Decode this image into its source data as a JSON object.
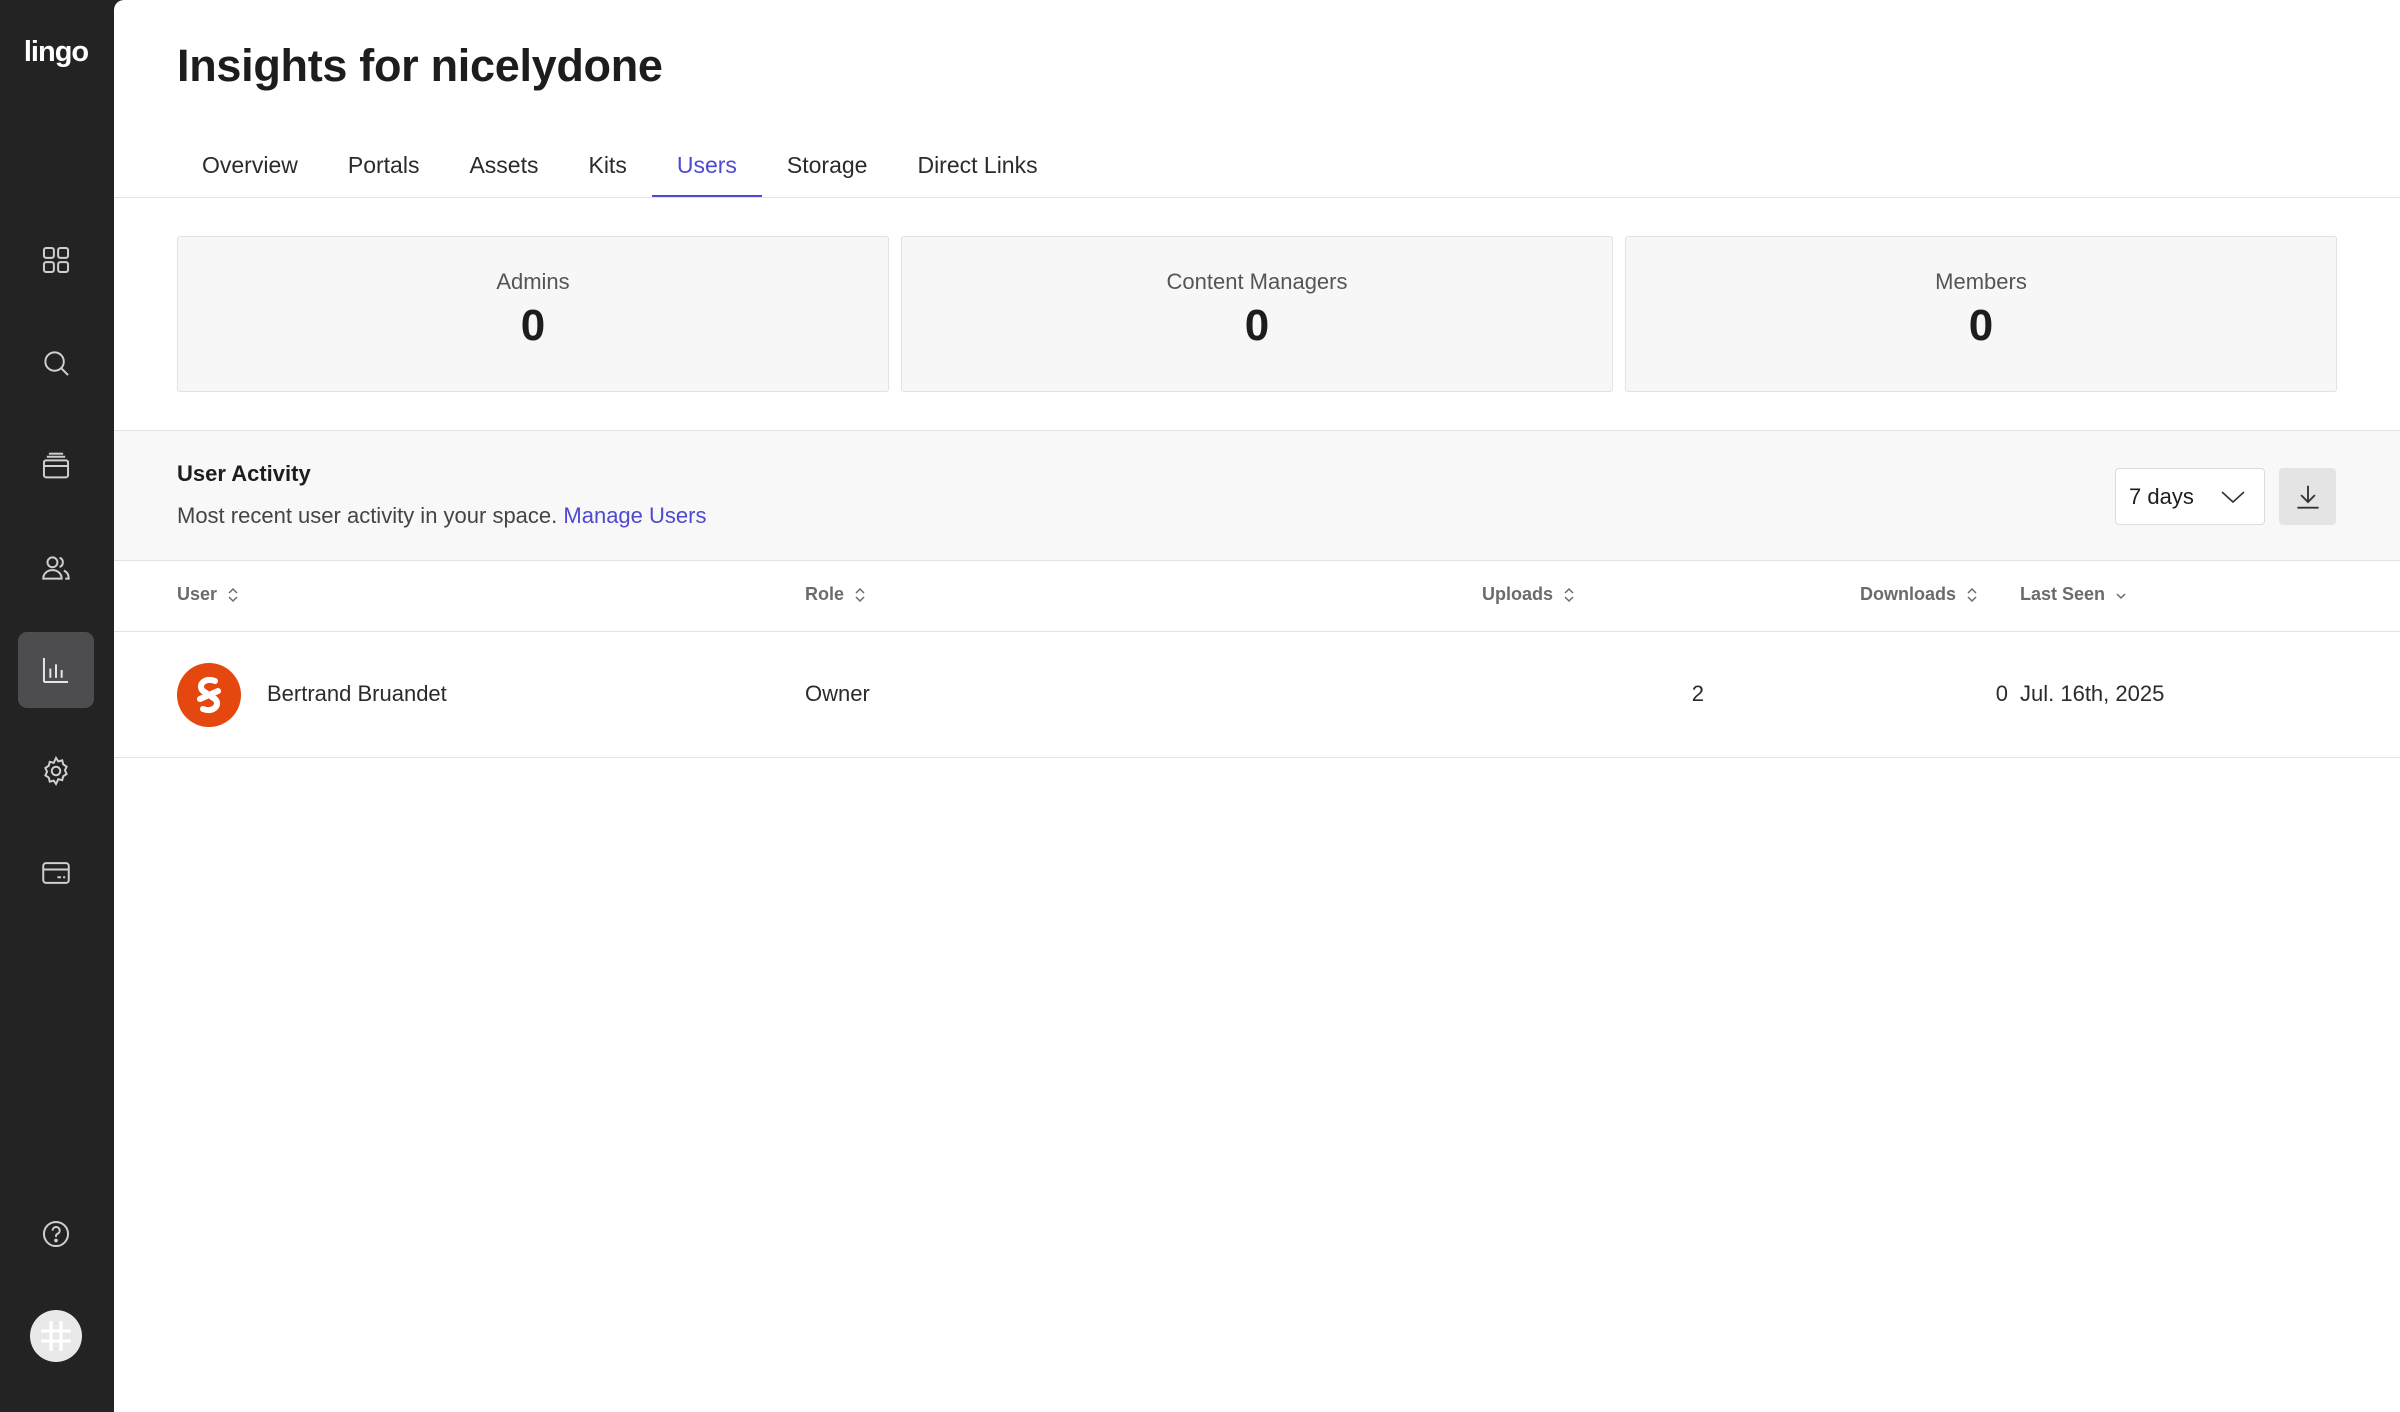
{
  "app": {
    "logo_text": "lingo"
  },
  "sidebar": {
    "items": [
      {
        "name": "dashboard",
        "icon": "grid-icon"
      },
      {
        "name": "search",
        "icon": "search-icon"
      },
      {
        "name": "library",
        "icon": "archive-icon"
      },
      {
        "name": "users",
        "icon": "users-icon"
      },
      {
        "name": "insights",
        "icon": "bar-chart-icon",
        "active": true
      },
      {
        "name": "settings",
        "icon": "gear-icon"
      },
      {
        "name": "billing",
        "icon": "credit-card-icon"
      }
    ],
    "help_icon": "help-icon",
    "account_icon": "account-avatar-icon"
  },
  "page": {
    "title": "Insights for nicelydone"
  },
  "tabs": [
    {
      "label": "Overview"
    },
    {
      "label": "Portals"
    },
    {
      "label": "Assets"
    },
    {
      "label": "Kits"
    },
    {
      "label": "Users",
      "active": true
    },
    {
      "label": "Storage"
    },
    {
      "label": "Direct Links"
    }
  ],
  "stats": [
    {
      "label": "Admins",
      "value": "0"
    },
    {
      "label": "Content Managers",
      "value": "0"
    },
    {
      "label": "Members",
      "value": "0"
    }
  ],
  "activity": {
    "title": "User Activity",
    "description": "Most recent user activity in your space.",
    "manage_link": "Manage Users",
    "period": {
      "selected": "7 days"
    },
    "download_icon": "download-icon"
  },
  "table": {
    "columns": [
      {
        "label": "User",
        "sort_icon": "sort-icon"
      },
      {
        "label": "Role",
        "sort_icon": "sort-icon"
      },
      {
        "label": "Uploads",
        "sort_icon": "sort-icon"
      },
      {
        "label": "Downloads",
        "sort_icon": "sort-icon"
      },
      {
        "label": "Last Seen",
        "sort_icon": "chevron-down-icon"
      }
    ],
    "rows": [
      {
        "user": "Bertrand Bruandet",
        "role": "Owner",
        "uploads": "2",
        "downloads": "0",
        "last_seen": "Jul. 16th, 2025"
      }
    ]
  },
  "colors": {
    "accent": "#4e4acf",
    "sidebar": "#232323",
    "avatar": "#e5480f"
  }
}
